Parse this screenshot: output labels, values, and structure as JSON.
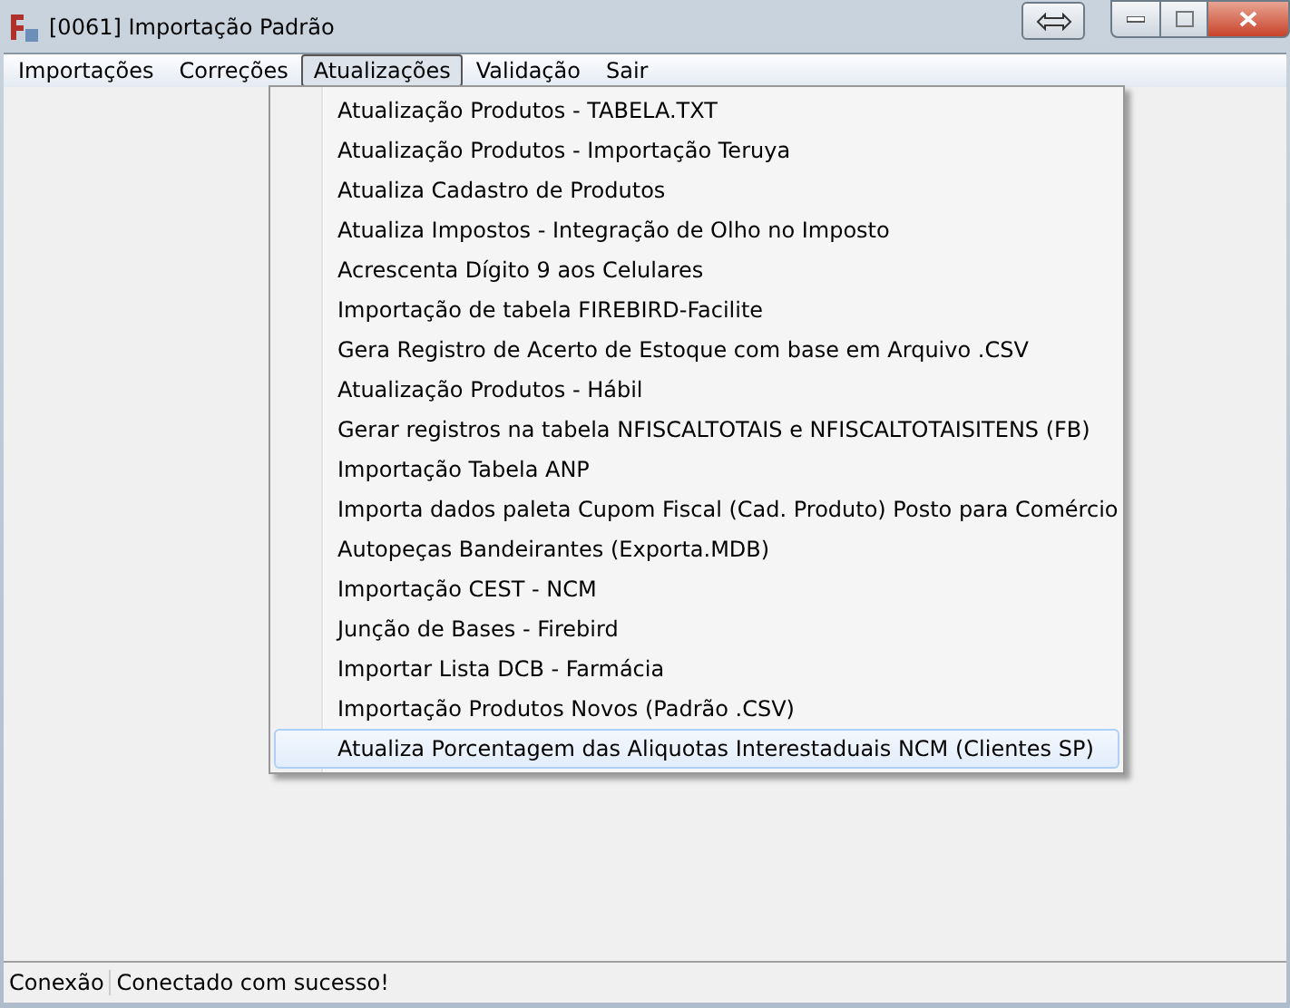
{
  "window": {
    "title": "[0061] Importação Padrão"
  },
  "menu_bar": [
    {
      "label": "Importações",
      "selected": false
    },
    {
      "label": "Correções",
      "selected": false
    },
    {
      "label": "Atualizações",
      "selected": true
    },
    {
      "label": "Validação",
      "selected": false
    },
    {
      "label": "Sair",
      "selected": false
    }
  ],
  "dropdown": {
    "items": [
      {
        "label": "Atualização Produtos - TABELA.TXT",
        "selected": false
      },
      {
        "label": "Atualização Produtos - Importação Teruya",
        "selected": false
      },
      {
        "label": "Atualiza Cadastro de Produtos",
        "selected": false
      },
      {
        "label": "Atualiza Impostos - Integração de Olho no Imposto",
        "selected": false
      },
      {
        "label": "Acrescenta Dígito 9 aos Celulares",
        "selected": false
      },
      {
        "label": "Importação de tabela FIREBIRD-Facilite",
        "selected": false
      },
      {
        "label": "Gera Registro de Acerto de Estoque com base em Arquivo .CSV",
        "selected": false
      },
      {
        "label": "Atualização Produtos - Hábil",
        "selected": false
      },
      {
        "label": "Gerar registros na tabela NFISCALTOTAIS e NFISCALTOTAISITENS (FB)",
        "selected": false
      },
      {
        "label": "Importação Tabela ANP",
        "selected": false
      },
      {
        "label": "Importa dados paleta Cupom Fiscal (Cad. Produto) Posto para Comércio",
        "selected": false
      },
      {
        "label": "Autopeças Bandeirantes (Exporta.MDB)",
        "selected": false
      },
      {
        "label": "Importação CEST - NCM",
        "selected": false
      },
      {
        "label": "Junção de Bases - Firebird",
        "selected": false
      },
      {
        "label": "Importar Lista DCB - Farmácia",
        "selected": false
      },
      {
        "label": "Importação Produtos Novos (Padrão .CSV)",
        "selected": false
      },
      {
        "label": "Atualiza Porcentagem das Aliquotas Interestaduais NCM (Clientes SP)",
        "selected": true
      }
    ]
  },
  "status_bar": [
    {
      "text": "Conexão"
    },
    {
      "text": "Conectado com sucesso!"
    }
  ]
}
